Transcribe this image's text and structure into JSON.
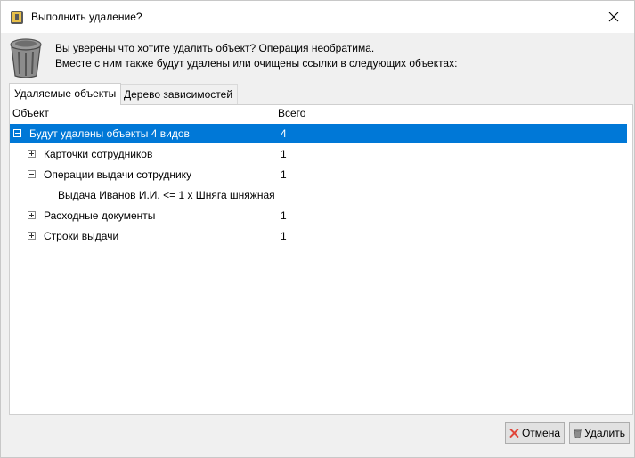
{
  "window": {
    "title": "Выполнить удаление?"
  },
  "message": {
    "line1": "Вы уверены что хотите удалить объект? Операция необратима.",
    "line2": "Вместе с ним также будут удалены или очищены ссылки в следующих объектах:"
  },
  "tabs": [
    {
      "label": "Удаляемые объекты",
      "active": true
    },
    {
      "label": "Дерево зависимостей",
      "active": false
    }
  ],
  "table": {
    "headers": {
      "object": "Объект",
      "total": "Всего"
    },
    "rows": [
      {
        "label": "Будут удалены объекты 4 видов",
        "count": "4",
        "expander": "minus",
        "level": 0,
        "selected": true
      },
      {
        "label": "Карточки сотрудников",
        "count": "1",
        "expander": "plus",
        "level": 1
      },
      {
        "label": "Операции выдачи сотруднику",
        "count": "1",
        "expander": "minus",
        "level": 1
      },
      {
        "label": "Выдача Иванов И.И. <= 1 x Шняга шняжная",
        "count": "",
        "expander": "none",
        "level": 2
      },
      {
        "label": "Расходные документы",
        "count": "1",
        "expander": "plus",
        "level": 1
      },
      {
        "label": "Строки выдачи",
        "count": "1",
        "expander": "plus",
        "level": 1
      }
    ]
  },
  "buttons": {
    "cancel": "Отмена",
    "delete": "Удалить"
  },
  "colors": {
    "selection": "#0078d7",
    "cancel_icon": "#e0453a"
  }
}
